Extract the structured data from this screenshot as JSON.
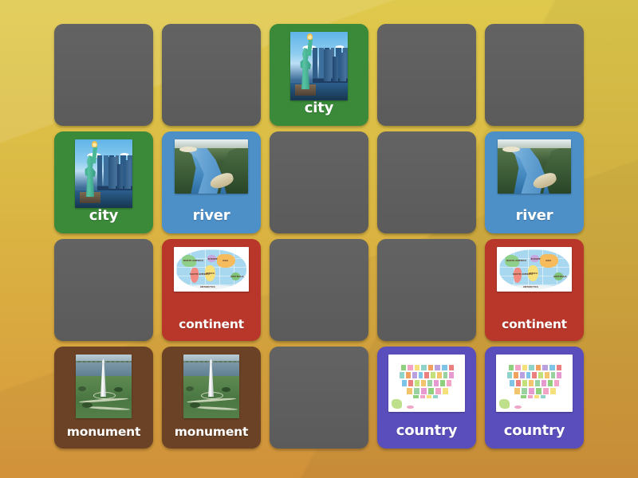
{
  "app": {
    "type": "matching-pairs-memory-game",
    "board_columns": 5,
    "board_rows": 4,
    "total_cards": 20
  },
  "background": {
    "gradient_top": "#dfc94c",
    "gradient_bottom": "#d9963c"
  },
  "card_styles": {
    "hidden": "#5e5e5e",
    "city": "#3a8a3a",
    "river": "#4d90c8",
    "continent": "#b8372a",
    "monument": "#6b4226",
    "country": "#5a4ebd"
  },
  "labels": {
    "city": "city",
    "river": "river",
    "continent": "continent",
    "monument": "monument",
    "country": "country"
  },
  "world_map_labels": {
    "north_america": "NORTH AMERICA",
    "south_america": "SOUTH AMERICA",
    "europe": "EUROPE",
    "africa": "AFRICA",
    "asia": "ASIA",
    "australia": "AUSTRALIA",
    "antarctica": "ANTARCTICA"
  },
  "cards": [
    {
      "index": 0,
      "row": 1,
      "col": 1,
      "state": "hidden",
      "label": "",
      "art": ""
    },
    {
      "index": 1,
      "row": 1,
      "col": 2,
      "state": "hidden",
      "label": "",
      "art": ""
    },
    {
      "index": 2,
      "row": 1,
      "col": 3,
      "state": "revealed",
      "label": "city",
      "art": "city-skyline-image",
      "color": "#3a8a3a"
    },
    {
      "index": 3,
      "row": 1,
      "col": 4,
      "state": "hidden",
      "label": "",
      "art": ""
    },
    {
      "index": 4,
      "row": 1,
      "col": 5,
      "state": "hidden",
      "label": "",
      "art": ""
    },
    {
      "index": 5,
      "row": 2,
      "col": 1,
      "state": "revealed",
      "label": "city",
      "art": "city-skyline-image",
      "color": "#3a8a3a"
    },
    {
      "index": 6,
      "row": 2,
      "col": 2,
      "state": "revealed",
      "label": "river",
      "art": "river-aerial-image",
      "color": "#4d90c8"
    },
    {
      "index": 7,
      "row": 2,
      "col": 3,
      "state": "hidden",
      "label": "",
      "art": ""
    },
    {
      "index": 8,
      "row": 2,
      "col": 4,
      "state": "hidden",
      "label": "",
      "art": ""
    },
    {
      "index": 9,
      "row": 2,
      "col": 5,
      "state": "revealed",
      "label": "river",
      "art": "river-aerial-image",
      "color": "#4d90c8"
    },
    {
      "index": 10,
      "row": 3,
      "col": 1,
      "state": "hidden",
      "label": "",
      "art": ""
    },
    {
      "index": 11,
      "row": 3,
      "col": 2,
      "state": "revealed",
      "label": "continent",
      "art": "world-map-image",
      "color": "#b8372a"
    },
    {
      "index": 12,
      "row": 3,
      "col": 3,
      "state": "hidden",
      "label": "",
      "art": ""
    },
    {
      "index": 13,
      "row": 3,
      "col": 4,
      "state": "hidden",
      "label": "",
      "art": ""
    },
    {
      "index": 14,
      "row": 3,
      "col": 5,
      "state": "revealed",
      "label": "continent",
      "art": "world-map-image",
      "color": "#b8372a"
    },
    {
      "index": 15,
      "row": 4,
      "col": 1,
      "state": "revealed",
      "label": "monument",
      "art": "washington-monument-image",
      "color": "#6b4226"
    },
    {
      "index": 16,
      "row": 4,
      "col": 2,
      "state": "revealed",
      "label": "monument",
      "art": "washington-monument-image",
      "color": "#6b4226"
    },
    {
      "index": 17,
      "row": 4,
      "col": 3,
      "state": "hidden",
      "label": "",
      "art": ""
    },
    {
      "index": 18,
      "row": 4,
      "col": 4,
      "state": "revealed",
      "label": "country",
      "art": "usa-map-image",
      "color": "#5a4ebd"
    },
    {
      "index": 19,
      "row": 4,
      "col": 5,
      "state": "revealed",
      "label": "country",
      "art": "usa-map-image",
      "color": "#5a4ebd"
    }
  ]
}
